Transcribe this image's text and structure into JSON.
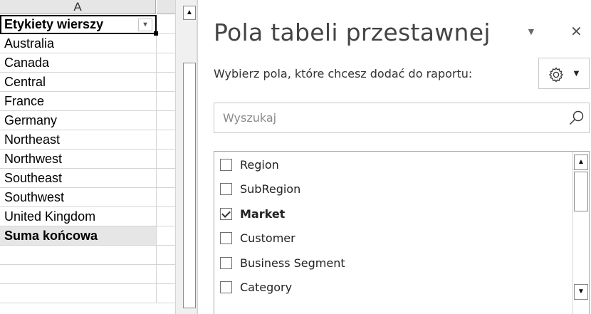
{
  "sheet": {
    "column_header": "A",
    "header_cell": "Etykiety wierszy",
    "filter_button": "▾",
    "rows": [
      "Australia",
      "Canada",
      "Central",
      "France",
      "Germany",
      "Northeast",
      "Northwest",
      "Southeast",
      "Southwest",
      "United Kingdom"
    ],
    "total_cell": "Suma końcowa",
    "empty_rows": [
      "",
      "",
      ""
    ]
  },
  "scrollbar": {
    "up_arrow": "▲",
    "down_arrow": "▼"
  },
  "pane": {
    "title": "Pola tabeli przestawnej",
    "dropdown_icon": "▼",
    "close_icon": "✕",
    "choose_label": "Wybierz pola, które chcesz dodać do raportu:",
    "settings_caret": "▼",
    "search_placeholder": "Wyszukaj",
    "fields": [
      {
        "label": "Region",
        "checked": false
      },
      {
        "label": "SubRegion",
        "checked": false
      },
      {
        "label": "Market",
        "checked": true
      },
      {
        "label": "Customer",
        "checked": false
      },
      {
        "label": "Business Segment",
        "checked": false
      },
      {
        "label": "Category",
        "checked": false
      }
    ]
  },
  "icons": {
    "settings": "gear-icon",
    "search": "search-icon",
    "close": "close-icon",
    "dropdown": "chevron-down-icon"
  }
}
